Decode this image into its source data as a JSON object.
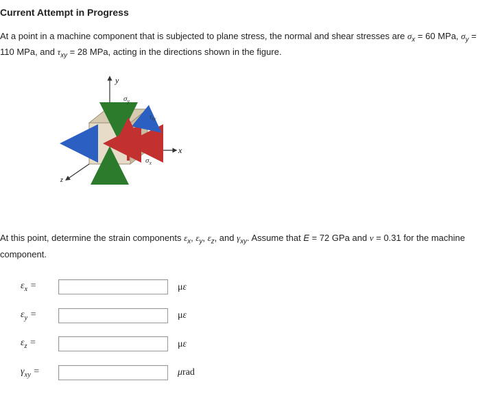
{
  "title": "Current Attempt in Progress",
  "problem": {
    "prefix": "At a point in a machine component that is subjected to plane stress, the normal and shear stresses are ",
    "sigma_x_sym": "σ",
    "sigma_x_sub": "x",
    "eq": "  =  ",
    "sigma_x_val": " 60 MPa, ",
    "sigma_y_sym": "σ",
    "sigma_y_sub": "y",
    "sigma_y_val": "110 MPa, and ",
    "tau_sym": "τ",
    "tau_sub": "xy",
    "tau_val": "  28 MPa, acting in the directions shown in the figure.",
    "eq2": "  =  "
  },
  "instructions": {
    "prefix": "At this point, determine the strain components ",
    "e1s": "ε",
    "e1sub": "x",
    "comma": ", ",
    "e2s": "ε",
    "e2sub": "y",
    "e3s": "ε",
    "e3sub": "z",
    "and": ", and ",
    "g1s": "γ",
    "g1sub": "xy",
    "suffix": ". Assume that ",
    "E": "E",
    "Eval": " = 72 GPa and ",
    "v": "ν",
    "vval": " = 0.31 for the machine component."
  },
  "inputs": {
    "ex": {
      "sym": "ε",
      "sub": "x",
      "eq": " =",
      "unit_pre": "μ",
      "unit": "ε"
    },
    "ey": {
      "sym": "ε",
      "sub": "y",
      "eq": " =",
      "unit_pre": "μ",
      "unit": "ε"
    },
    "ez": {
      "sym": "ε",
      "sub": "z",
      "eq": " =",
      "unit_pre": "μ",
      "unit": "ε"
    },
    "gxy": {
      "sym": "γ",
      "sub": "xy",
      "eq": " =",
      "unit_pre": "μ",
      "unit": "rad"
    }
  },
  "figure": {
    "labels": {
      "y": "y",
      "x": "x",
      "z": "z",
      "sigma_y": "σy",
      "sigma_x": "σx",
      "tau_xy": "τxy"
    }
  }
}
